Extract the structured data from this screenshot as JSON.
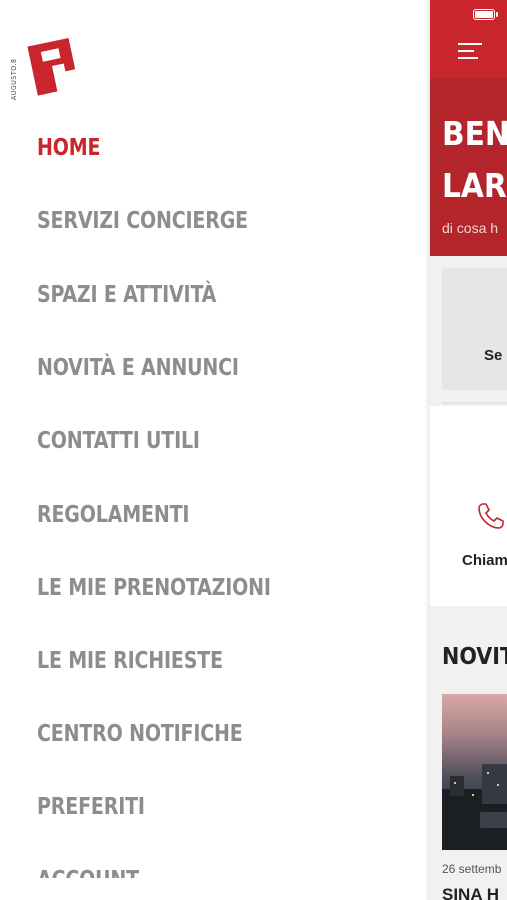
{
  "drawer": {
    "logo_text": "AUGUSTO.8",
    "menu": [
      {
        "label": "HOME",
        "active": true
      },
      {
        "label": "SERVIZI CONCIERGE",
        "active": false
      },
      {
        "label": "SPAZI E ATTIVITÀ",
        "active": false
      },
      {
        "label": "NOVITÀ E ANNUNCI",
        "active": false
      },
      {
        "label": "CONTATTI UTILI",
        "active": false
      },
      {
        "label": "REGOLAMENTI",
        "active": false
      },
      {
        "label": "LE MIE PRENOTAZIONI",
        "active": false
      },
      {
        "label": "LE MIE RICHIESTE",
        "active": false
      },
      {
        "label": "CENTRO NOTIFICHE",
        "active": false
      },
      {
        "label": "PREFERITI",
        "active": false
      },
      {
        "label": "ACCOUNT",
        "active": false
      }
    ]
  },
  "main": {
    "hero": {
      "title_line1": "BENV",
      "title_line2": "LARG",
      "subtitle": "di cosa h"
    },
    "card_label": "Se",
    "call_label": "Chiam",
    "news": {
      "section_title": "NOVITÀ",
      "date": "26 settemb",
      "headline": "SINA H"
    }
  },
  "colors": {
    "brand_red": "#c8262c",
    "menu_gray": "#8d8d8d"
  },
  "icons": {
    "menu": "hamburger-icon",
    "phone": "phone-icon",
    "battery": "battery-icon"
  }
}
